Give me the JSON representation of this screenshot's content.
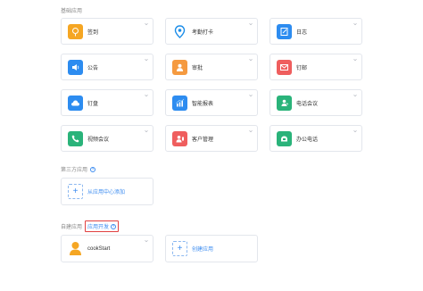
{
  "sections": {
    "basic": "基础应用",
    "third_party": "第三方应用",
    "custom": "自建应用",
    "custom_dev_link": "应用开发"
  },
  "apps": [
    {
      "label": "签到",
      "icon": "location-pin-icon",
      "color": "#f5a623"
    },
    {
      "label": "考勤打卡",
      "icon": "map-pin-icon",
      "color": "#1c8de8"
    },
    {
      "label": "日志",
      "icon": "journal-pen-icon",
      "color": "#2d8cf0"
    },
    {
      "label": "公告",
      "icon": "speaker-icon",
      "color": "#2d8cf0"
    },
    {
      "label": "审批",
      "icon": "approval-user-icon",
      "color": "#f59a40"
    },
    {
      "label": "钉邮",
      "icon": "mail-icon",
      "color": "#ef5e5e"
    },
    {
      "label": "钉盘",
      "icon": "cloud-icon",
      "color": "#2d8cf0"
    },
    {
      "label": "智能报表",
      "icon": "report-chart-icon",
      "color": "#2d8cf0"
    },
    {
      "label": "电话会议",
      "icon": "phone-conference-icon",
      "color": "#2ab37a"
    },
    {
      "label": "视频会议",
      "icon": "video-phone-icon",
      "color": "#2ab37a"
    },
    {
      "label": "客户管理",
      "icon": "customer-icon",
      "color": "#ef5e5e"
    },
    {
      "label": "办公电话",
      "icon": "office-phone-icon",
      "color": "#2ab37a"
    }
  ],
  "third_party_add": "从应用中心添加",
  "custom_apps": [
    {
      "label": "cookStart",
      "icon": "person-avatar-icon",
      "color": "#f5a623"
    }
  ],
  "custom_add": "创建应用",
  "help_glyph": "?"
}
